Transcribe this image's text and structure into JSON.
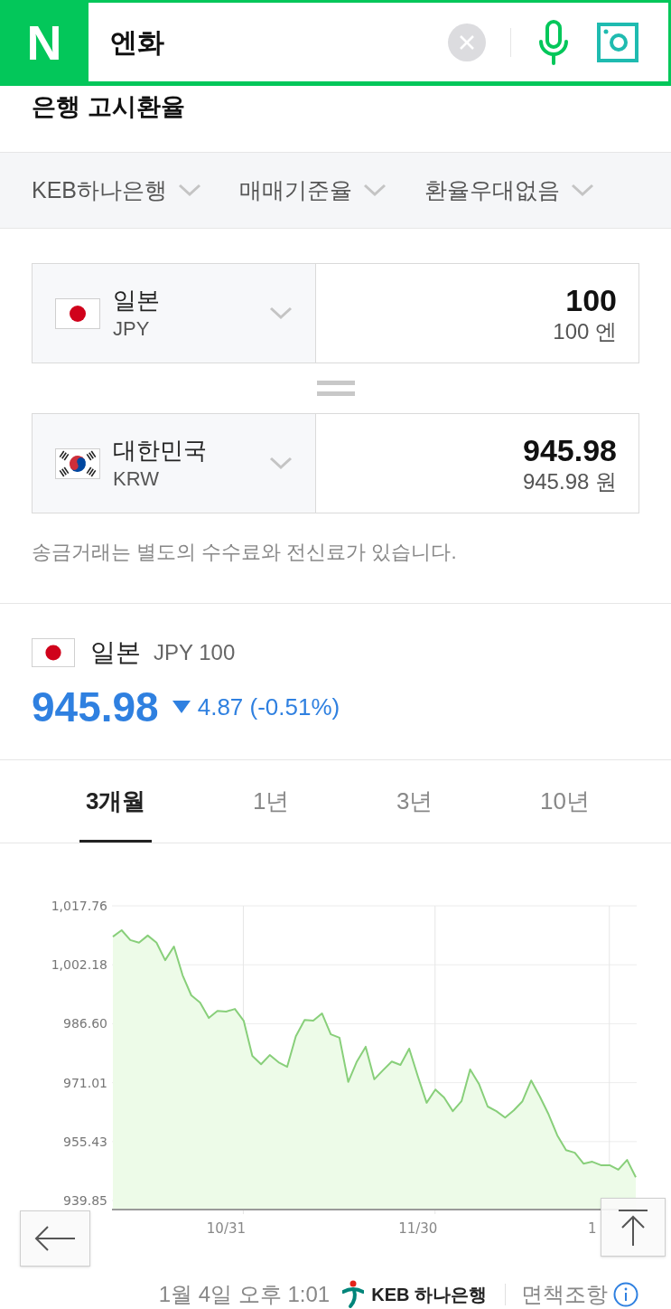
{
  "search_bar": {
    "logo": "N",
    "query": "엔화"
  },
  "section_title": "은행 고시환율",
  "filters": [
    {
      "label": "KEB하나은행"
    },
    {
      "label": "매매기준율"
    },
    {
      "label": "환율우대없음"
    }
  ],
  "converter": {
    "rows": [
      {
        "kind": "japan",
        "country": "일본",
        "code": "JPY",
        "amount": "100",
        "amount_text": "100 엔"
      },
      {
        "kind": "korea",
        "country": "대한민국",
        "code": "KRW",
        "amount": "945.98",
        "amount_text": "945.98 원"
      }
    ],
    "note": "송금거래는 별도의 수수료와 전신료가 있습니다."
  },
  "quote": {
    "kind": "japan",
    "country": "일본",
    "unit": "JPY 100",
    "rate": "945.98",
    "declined": true,
    "change": "4.87 (-0.51%)"
  },
  "period_tabs": [
    {
      "label": "3개월",
      "selected": true
    },
    {
      "label": "1년",
      "selected": false
    },
    {
      "label": "3년",
      "selected": false
    },
    {
      "label": "10년",
      "selected": false
    }
  ],
  "chart": {
    "chart_data": {
      "type": "area",
      "grid": true,
      "categories": [
        null,
        null,
        null,
        null,
        null,
        null,
        null,
        null,
        null,
        null,
        null,
        null,
        null,
        "10/31",
        null,
        null,
        null,
        null,
        null,
        null,
        null,
        null,
        null,
        null,
        null,
        null,
        null,
        null,
        null,
        null,
        null,
        null,
        null,
        null,
        null,
        "11/30",
        null,
        null,
        null,
        null,
        null,
        null,
        null,
        null,
        null,
        null,
        null,
        null,
        null,
        null,
        null,
        null,
        null,
        null,
        null,
        "1",
        null,
        null,
        null,
        null,
        null
      ],
      "values": [
        1009.6,
        1011.3,
        1008.7,
        1008.0,
        1009.9,
        1008.0,
        1003.4,
        1007.0,
        999.4,
        994.1,
        992.2,
        988.1,
        990.0,
        989.8,
        990.5,
        987.4,
        978.1,
        975.9,
        978.3,
        976.4,
        975.2,
        983.3,
        987.6,
        987.4,
        989.3,
        983.8,
        982.9,
        971.2,
        976.6,
        980.5,
        971.9,
        974.3,
        976.6,
        975.7,
        980.0,
        972.6,
        965.7,
        969.2,
        967.1,
        963.5,
        966.1,
        974.5,
        970.7,
        964.7,
        963.5,
        961.8,
        963.7,
        966.1,
        971.6,
        967.3,
        962.6,
        957.1,
        953.2,
        952.5,
        949.6,
        950.1,
        949.2,
        949.2,
        948.0,
        950.6,
        946.0
      ],
      "ylim": [
        937.47,
        1017.76
      ],
      "yticks": [
        {
          "value": 1017.76,
          "label": "1,017.76"
        },
        {
          "value": 1002.18,
          "label": "1,002.18"
        },
        {
          "value": 986.6,
          "label": "986.60"
        },
        {
          "value": 971.01,
          "label": "971.01"
        },
        {
          "value": 955.43,
          "label": "955.43"
        },
        {
          "value": 939.85,
          "label": "939.85"
        }
      ]
    }
  },
  "footer": {
    "timestamp": "1월 4일 오후 1:01",
    "bank": "KEB 하나은행",
    "disclaimer": "면책조항"
  }
}
